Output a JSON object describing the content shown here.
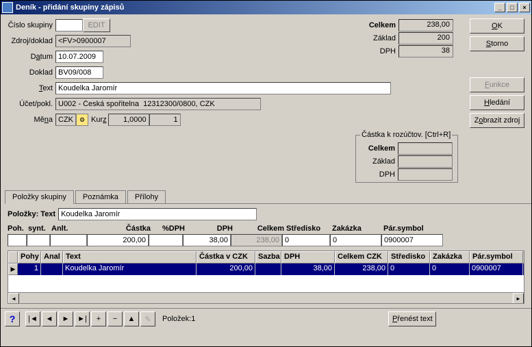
{
  "window": {
    "title": "Deník - přidání skupiny zápisů"
  },
  "form": {
    "cislo_skupiny_label": "Číslo skupiny",
    "edit_btn": "EDIT",
    "zdroj_label": "Zdroj/doklad",
    "zdroj_value": "<FV>0900007",
    "datum_label_pre": "D",
    "datum_label_u": "a",
    "datum_label_post": "tum",
    "datum_value": "10.07.2009",
    "doklad_label": "Doklad",
    "doklad_value": "BV09/008",
    "text_label_u": "T",
    "text_label_post": "ext",
    "text_value": "Koudelka Jaromír",
    "ucet_label": "Účet/pokl.",
    "ucet_value": "U002 - Česká spořitelna  12312300/0800, CZK",
    "mena_label_pre": "Mě",
    "mena_label_u": "n",
    "mena_label_post": "a",
    "mena_value": "CZK",
    "kurz_label_pre": "Kur",
    "kurz_label_u": "z",
    "kurz_value1": "1,0000",
    "kurz_value2": "1"
  },
  "totals": {
    "celkem_label": "Celkem",
    "celkem_value": "238,00",
    "zaklad_label": "Základ",
    "zaklad_value": "200",
    "dph_label": "DPH",
    "dph_value": "38"
  },
  "buttons": {
    "ok_u": "O",
    "ok_post": "K",
    "storno_u": "S",
    "storno_post": "torno",
    "funkce_u": "F",
    "funkce_post": "unkce",
    "hledani_u": "H",
    "hledani_post": "ledání",
    "zobrazit_pre": "Z",
    "zobrazit_u": "o",
    "zobrazit_post": "brazit zdroj"
  },
  "rozuct": {
    "legend": "Částka k rozúčtov. [Ctrl+R]",
    "celkem_label": "Celkem",
    "zaklad_label": "Základ",
    "dph_label": "DPH"
  },
  "tabs": {
    "polozky": "Položky skupiny",
    "poznamka": "Poznámka",
    "prilohy": "Přílohy"
  },
  "polozky": {
    "label": "Položky: Text",
    "text_value": "Koudelka Jaromír",
    "headers": {
      "poh": "Poh.",
      "synt": "synt.",
      "anlt": "Anlt.",
      "castka": "Částka",
      "pct_dph": "%DPH",
      "dph": "DPH",
      "celkem": "Celkem",
      "stredisko": "Středisko",
      "zakazka": "Zakázka",
      "par_symbol": "Pár.symbol"
    },
    "inputs": {
      "poh": "",
      "synt": "",
      "anlt": "",
      "castka": "200,00",
      "pct_dph": "",
      "dph": "38,00",
      "celkem": "238,00",
      "stredisko": "0",
      "zakazka": "0",
      "par_symbol": "0900007"
    }
  },
  "grid": {
    "headers": [
      "",
      "Pohy",
      "Anal",
      "Text",
      "Částka v CZK",
      "Sazba",
      "DPH",
      "Celkem CZK",
      "Středisko",
      "Zakázka",
      "Pár.symbol"
    ],
    "row": [
      "",
      "1",
      "",
      "Koudelka Jaromír",
      "200,00",
      "",
      "38,00",
      "238,00",
      "0",
      "0",
      "0900007"
    ]
  },
  "footer": {
    "polozek": "Položek:1",
    "prenest_u": "P",
    "prenest_post": "řenést text"
  }
}
